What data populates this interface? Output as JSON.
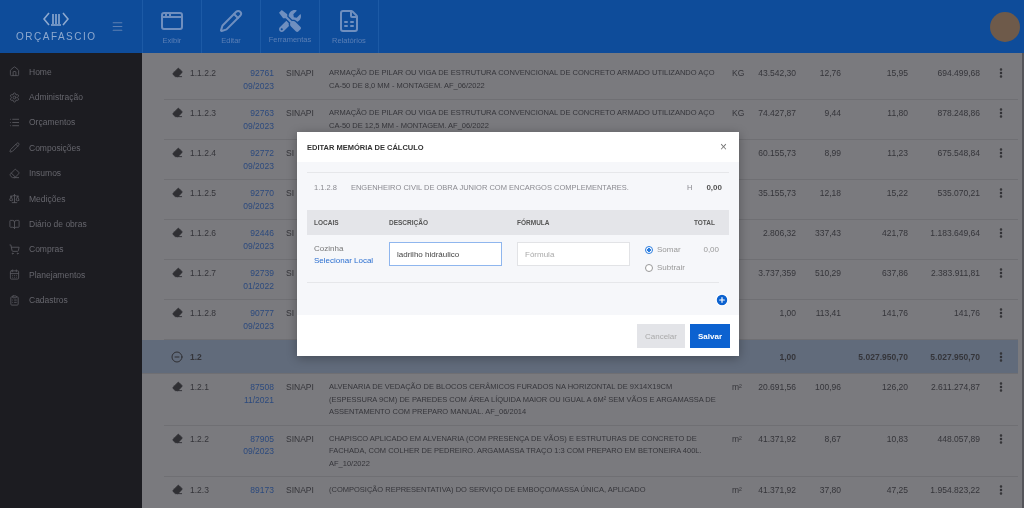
{
  "header": {
    "logo": "ORÇAFASCIO",
    "toolbar": [
      {
        "label": "Exibir",
        "kind": "view"
      },
      {
        "label": "Editar",
        "kind": "edit"
      },
      {
        "label": "Ferramentas",
        "kind": "tools"
      },
      {
        "label": "Relatórios",
        "kind": "report"
      }
    ]
  },
  "sidebar": {
    "items": [
      {
        "label": "Home",
        "kind": "home"
      },
      {
        "label": "Administração",
        "kind": "admin"
      },
      {
        "label": "Orçamentos",
        "kind": "list"
      },
      {
        "label": "Composições",
        "kind": "compose"
      },
      {
        "label": "Insumos",
        "kind": "input"
      },
      {
        "label": "Medições",
        "kind": "measure"
      },
      {
        "label": "Diário de obras",
        "kind": "diary"
      },
      {
        "label": "Compras",
        "kind": "cart"
      },
      {
        "label": "Planejamentos",
        "kind": "calendar"
      },
      {
        "label": "Cadastros",
        "kind": "register"
      }
    ]
  },
  "table": {
    "rows": [
      {
        "kind": "item",
        "item": "1.1.2.2",
        "code": "92761",
        "date": "09/2023",
        "source": "SINAPI",
        "description": "ARMAÇÃO DE PILAR OU VIGA DE ESTRUTURA CONVENCIONAL DE CONCRETO ARMADO UTILIZANDO AÇO CA-50 DE 8,0 MM - MONTAGEM. AF_06/2022",
        "unit": "KG",
        "quantity": "43.542,30",
        "price": "12,76",
        "price_bdi": "15,95",
        "total": "694.499,68"
      },
      {
        "kind": "item",
        "item": "1.1.2.3",
        "code": "92763",
        "date": "09/2023",
        "source": "SINAPI",
        "description": "ARMAÇÃO DE PILAR OU VIGA DE ESTRUTURA CONVENCIONAL DE CONCRETO ARMADO UTILIZANDO AÇO CA-50 DE 12,5 MM - MONTAGEM. AF_06/2022",
        "unit": "KG",
        "quantity": "74.427,87",
        "price": "9,44",
        "price_bdi": "11,80",
        "total": "878.248,86"
      },
      {
        "kind": "item",
        "item": "1.1.2.4",
        "code": "92772",
        "date": "09/2023",
        "source": "SI",
        "quantity": "60.155,73",
        "price": "8,99",
        "price_bdi": "11,23",
        "total": "675.548,84"
      },
      {
        "kind": "item",
        "item": "1.1.2.5",
        "code": "92770",
        "date": "09/2023",
        "source": "SI",
        "quantity": "35.155,73",
        "price": "12,18",
        "price_bdi": "15,22",
        "total": "535.070,21"
      },
      {
        "kind": "item",
        "item": "1.1.2.6",
        "code": "92446",
        "date": "09/2023",
        "source": "SI",
        "quantity": "2.806,32",
        "price": "337,43",
        "price_bdi": "421,78",
        "total": "1.183.649,64"
      },
      {
        "kind": "item",
        "item": "1.1.2.7",
        "code": "92739",
        "date": "01/2022",
        "source": "SI",
        "quantity": "3.737,359",
        "price": "510,29",
        "price_bdi": "637,86",
        "total": "2.383.911,81"
      },
      {
        "kind": "item",
        "item": "1.1.2.8",
        "code": "90777",
        "date": "09/2023",
        "source": "SI",
        "quantity": "1,00",
        "price": "113,41",
        "price_bdi": "141,76",
        "total": "141,76"
      },
      {
        "kind": "group",
        "item": "1.2",
        "quantity": "1,00",
        "price_bdi": "5.027.950,70",
        "total": "5.027.950,70"
      },
      {
        "kind": "item",
        "item": "1.2.1",
        "code": "87508",
        "date": "11/2021",
        "source": "SINAPI",
        "description": "ALVENARIA DE VEDAÇÃO DE BLOCOS CERÂMICOS FURADOS NA HORIZONTAL DE 9X14X19CM (ESPESSURA 9CM) DE PAREDES COM ÁREA LÍQUIDA MAIOR OU IGUAL A 6M² SEM VÃOS E ARGAMASSA DE ASSENTAMENTO COM PREPARO MANUAL. AF_06/2014",
        "unit": "m²",
        "quantity": "20.691,56",
        "price": "100,96",
        "price_bdi": "126,20",
        "total": "2.611.274,87"
      },
      {
        "kind": "item",
        "item": "1.2.2",
        "code": "87905",
        "date": "09/2023",
        "source": "SINAPI",
        "description": "CHAPISCO APLICADO EM ALVENARIA (COM PRESENÇA DE VÃOS) E ESTRUTURAS DE CONCRETO DE FACHADA, COM COLHER DE PEDREIRO. ARGAMASSA TRAÇO 1:3 COM PREPARO EM BETONEIRA 400L. AF_10/2022",
        "unit": "m²",
        "quantity": "41.371,92",
        "price": "8,67",
        "price_bdi": "10,83",
        "total": "448.057,89"
      },
      {
        "kind": "item",
        "item": "1.2.3",
        "code": "89173",
        "source": "SINAPI",
        "description": "(COMPOSIÇÃO REPRESENTATIVA) DO SERVIÇO DE EMBOÇO/MASSA ÚNICA, APLICADO",
        "unit": "m²",
        "quantity": "41.371,92",
        "price": "37,80",
        "price_bdi": "47,25",
        "total": "1.954.823,22"
      }
    ]
  },
  "modal": {
    "title": "EDITAR MEMÓRIA DE CÁLCULO",
    "close": "×",
    "summary": {
      "item": "1.1.2.8",
      "description": "ENGENHEIRO CIVIL DE OBRA JUNIOR COM ENCARGOS COMPLEMENTARES.",
      "unit": "H",
      "total": "0,00"
    },
    "columns": [
      "LOCAIS",
      "DESCRIÇÃO",
      "FÓRMULA",
      "TOTAL"
    ],
    "rows": [
      {
        "local": "Cozinha",
        "select_link": "Selecionar Local",
        "description": "ladrilho hidráulico",
        "formula_placeholder": "Fórmula",
        "operations": [
          {
            "label": "Somar",
            "selected": true
          },
          {
            "label": "Subtrair",
            "selected": false
          }
        ],
        "total": "0,00"
      }
    ],
    "buttons": [
      {
        "label": "Cancelar",
        "kind": "secondary"
      },
      {
        "label": "Salvar",
        "kind": "primary"
      }
    ]
  }
}
